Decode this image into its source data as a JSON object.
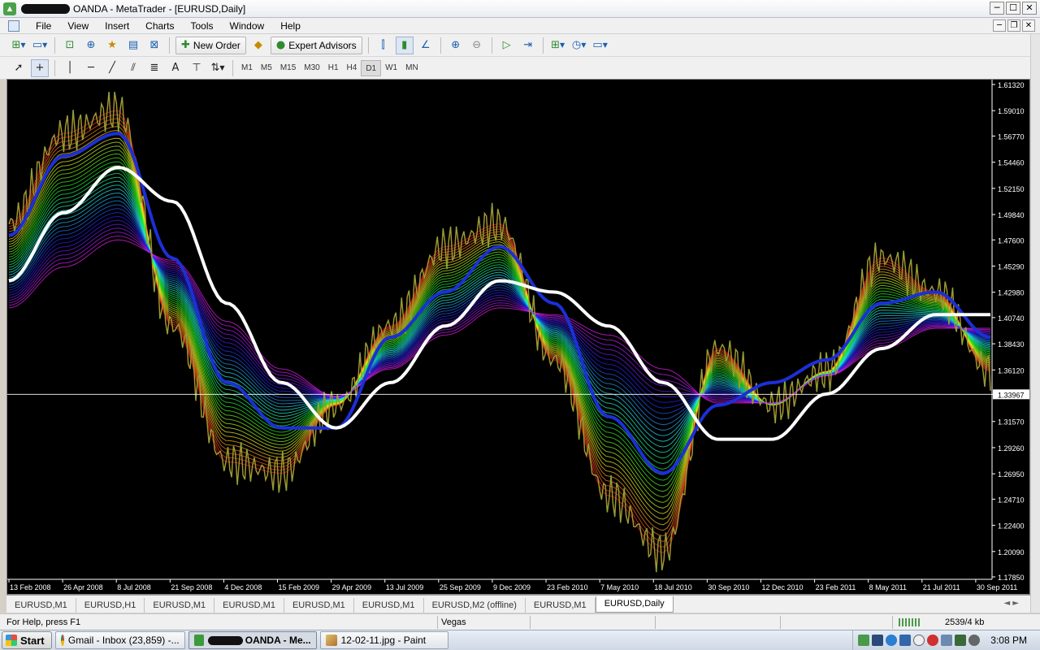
{
  "window": {
    "title": "OANDA - MetaTrader - [EURUSD,Daily]",
    "buttons": [
      "─",
      "☐",
      "✕"
    ],
    "mdi_buttons": [
      "─",
      "❐",
      "✕"
    ]
  },
  "menu": [
    "File",
    "View",
    "Insert",
    "Charts",
    "Tools",
    "Window",
    "Help"
  ],
  "toolbar": {
    "new_order": "New Order",
    "expert_advisors": "Expert Advisors"
  },
  "timeframes": [
    "M1",
    "M5",
    "M15",
    "M30",
    "H1",
    "H4",
    "D1",
    "W1",
    "MN"
  ],
  "active_timeframe": "D1",
  "chart": {
    "symbol": "EURUSD",
    "period": "Daily",
    "current_price": "1.33967",
    "price_labels": [
      "1.61320",
      "1.59010",
      "1.56770",
      "1.54460",
      "1.52150",
      "1.49840",
      "1.47600",
      "1.45290",
      "1.42980",
      "1.40740",
      "1.38430",
      "1.36120",
      "1.33967",
      "1.31570",
      "1.29260",
      "1.26950",
      "1.24710",
      "1.22400",
      "1.20090",
      "1.17850"
    ],
    "date_labels": [
      "13 Feb 2008",
      "26 Apr 2008",
      "8 Jul 2008",
      "21 Sep 2008",
      "4 Dec 2008",
      "15 Feb 2009",
      "29 Apr 2009",
      "13 Jul 2009",
      "25 Sep 2009",
      "9 Dec 2009",
      "23 Feb 2010",
      "7 May 2010",
      "18 Jul 2010",
      "30 Sep 2010",
      "12 Dec 2010",
      "23 Feb 2011",
      "8 May 2011",
      "21 Jul 2011",
      "30 Sep 2011"
    ],
    "colors": {
      "background": "#000000",
      "blue_ma": "#1c2fd6",
      "white_ma": "#ffffff",
      "price_line": "#ffffff"
    },
    "chart_data": {
      "type": "line",
      "ylim": [
        1.1785,
        1.6132
      ],
      "x": [
        "13 Feb 2008",
        "26 Apr 2008",
        "8 Jul 2008",
        "21 Sep 2008",
        "4 Dec 2008",
        "15 Feb 2009",
        "29 Apr 2009",
        "13 Jul 2009",
        "25 Sep 2009",
        "9 Dec 2009",
        "23 Feb 2010",
        "7 May 2010",
        "18 Jul 2010",
        "30 Sep 2010",
        "12 Dec 2010",
        "23 Feb 2011",
        "8 May 2011",
        "21 Jul 2011",
        "30 Sep 2011"
      ],
      "series": [
        {
          "values": [
            1.48,
            1.55,
            1.57,
            1.46,
            1.35,
            1.31,
            1.31,
            1.39,
            1.43,
            1.47,
            1.42,
            1.32,
            1.27,
            1.33,
            1.35,
            1.37,
            1.42,
            1.43,
            1.39
          ]
        },
        {
          "values": [
            1.44,
            1.5,
            1.54,
            1.51,
            1.42,
            1.35,
            1.31,
            1.35,
            1.4,
            1.44,
            1.43,
            1.4,
            1.35,
            1.3,
            1.3,
            1.34,
            1.38,
            1.41,
            1.41
          ]
        },
        {
          "values": [
            1.49,
            1.57,
            1.59,
            1.4,
            1.28,
            1.27,
            1.33,
            1.4,
            1.47,
            1.49,
            1.37,
            1.25,
            1.2,
            1.38,
            1.33,
            1.36,
            1.46,
            1.43,
            1.36
          ]
        }
      ]
    }
  },
  "tabs": [
    "EURUSD,M1",
    "EURUSD,H1",
    "EURUSD,M1",
    "EURUSD,M1",
    "EURUSD,M1",
    "EURUSD,M1",
    "EURUSD,M2 (offline)",
    "EURUSD,M1",
    "EURUSD,Daily"
  ],
  "active_tab": 8,
  "status": {
    "help": "For Help, press F1",
    "profile": "Vegas",
    "memory": "2539/4 kb"
  },
  "taskbar": {
    "start": "Start",
    "items": [
      "Gmail - Inbox (23,859) -...",
      "OANDA - Me...",
      "12-02-11.jpg - Paint"
    ],
    "clock": "3:08 PM"
  }
}
